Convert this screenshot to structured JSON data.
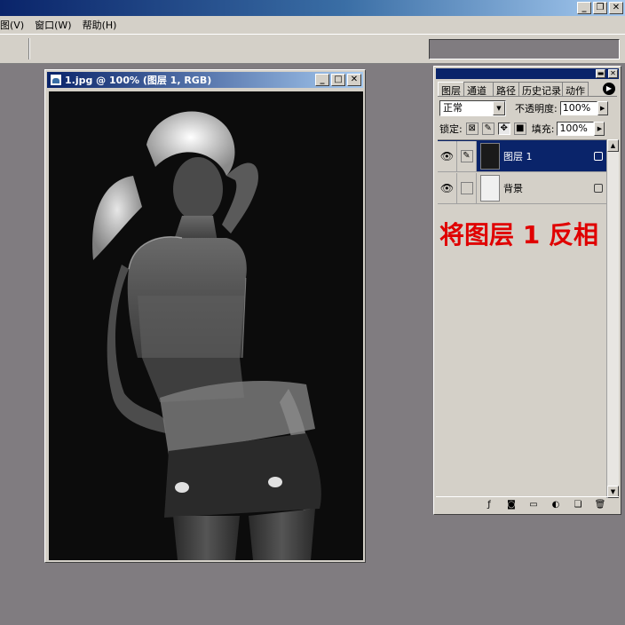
{
  "menubar": {
    "items": [
      "图(V)",
      "窗口(W)",
      "帮助(H)"
    ]
  },
  "document": {
    "title": "1.jpg @ 100% (图层 1, RGB)"
  },
  "panel": {
    "tabs": [
      "图层",
      "通道",
      "路径",
      "历史记录",
      "动作"
    ],
    "blend_mode": "正常",
    "opacity_label": "不透明度:",
    "opacity_value": "100%",
    "lock_label": "锁定:",
    "fill_label": "填充:",
    "fill_value": "100%",
    "layers": [
      {
        "name": "图层 1",
        "selected": true
      },
      {
        "name": "背景",
        "selected": false
      }
    ],
    "annotation": "将图层 1 反相"
  },
  "colors": {
    "desktop": "#807c80",
    "chrome": "#d4d0c8",
    "selection": "#0a246a",
    "annotation": "#e00000"
  }
}
